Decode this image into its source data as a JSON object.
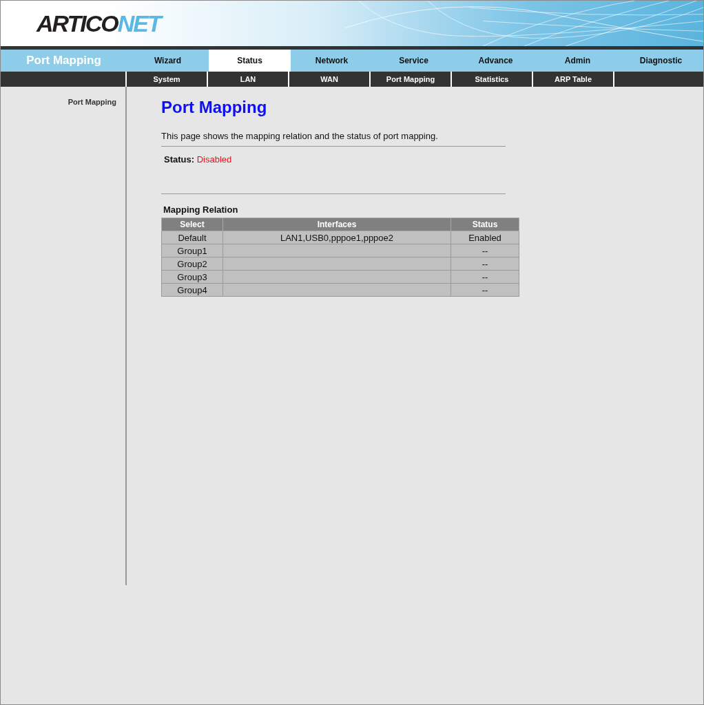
{
  "logo": {
    "dark": "ARTICO",
    "accent": "NET"
  },
  "section_title": "Port Mapping",
  "main_tabs": [
    {
      "label": "Wizard",
      "selected": false
    },
    {
      "label": "Status",
      "selected": true
    },
    {
      "label": "Network",
      "selected": false
    },
    {
      "label": "Service",
      "selected": false
    },
    {
      "label": "Advance",
      "selected": false
    },
    {
      "label": "Admin",
      "selected": false
    },
    {
      "label": "Diagnostic",
      "selected": false
    }
  ],
  "sub_tabs": [
    "System",
    "LAN",
    "WAN",
    "Port Mapping",
    "Statistics",
    "ARP Table"
  ],
  "sidebar": {
    "items": [
      "Port Mapping"
    ]
  },
  "page": {
    "title": "Port Mapping",
    "description": "This page shows the mapping relation and the status of port mapping.",
    "status_label": "Status:",
    "status_value": "Disabled"
  },
  "table": {
    "title": "Mapping Relation",
    "columns": [
      "Select",
      "Interfaces",
      "Status"
    ],
    "rows": [
      [
        "Default",
        "LAN1,USB0,pppoe1,pppoe2",
        "Enabled"
      ],
      [
        "Group1",
        "",
        "--"
      ],
      [
        "Group2",
        "",
        "--"
      ],
      [
        "Group3",
        "",
        "--"
      ],
      [
        "Group4",
        "",
        "--"
      ]
    ]
  }
}
